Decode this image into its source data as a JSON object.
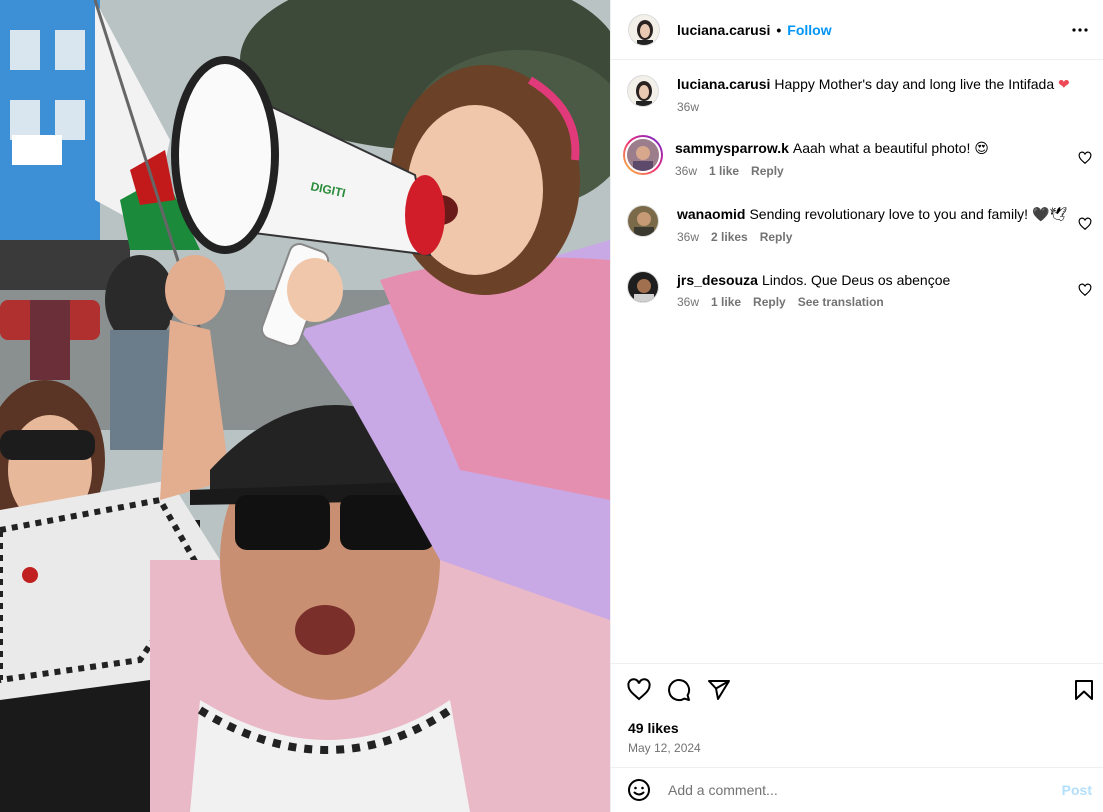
{
  "post": {
    "author": "luciana.carusi",
    "follow_label": "Follow",
    "separator": "•",
    "more_icon": "more-horizontal-icon"
  },
  "caption": {
    "username": "luciana.carusi",
    "text": "Happy Mother's day and long live the Intifada",
    "emoji": "❤",
    "time": "36w"
  },
  "comments": [
    {
      "username": "sammysparrow.k",
      "text": "Aaah what a beautiful photo!",
      "emoji": "😍",
      "time": "36w",
      "likes": "1 like",
      "reply": "Reply"
    },
    {
      "username": "wanaomid",
      "text": "Sending revolutionary love to you and family!",
      "emoji": "🖤🕊",
      "time": "36w",
      "likes": "2 likes",
      "reply": "Reply"
    },
    {
      "username": "jrs_desouza",
      "text": "Lindos. Que Deus os abençoe",
      "time": "36w",
      "likes": "1 like",
      "reply": "Reply",
      "translate": "See translation"
    }
  ],
  "footer": {
    "likes": "49 likes",
    "date": "May 12, 2024",
    "comment_placeholder": "Add a comment...",
    "post_label": "Post"
  },
  "colors": {
    "accent": "#0095f6",
    "heart": "#ed4956",
    "muted": "#737373",
    "post_disabled": "#b2dffc"
  },
  "photo": {
    "megaphone_brand": "DIGITI"
  }
}
